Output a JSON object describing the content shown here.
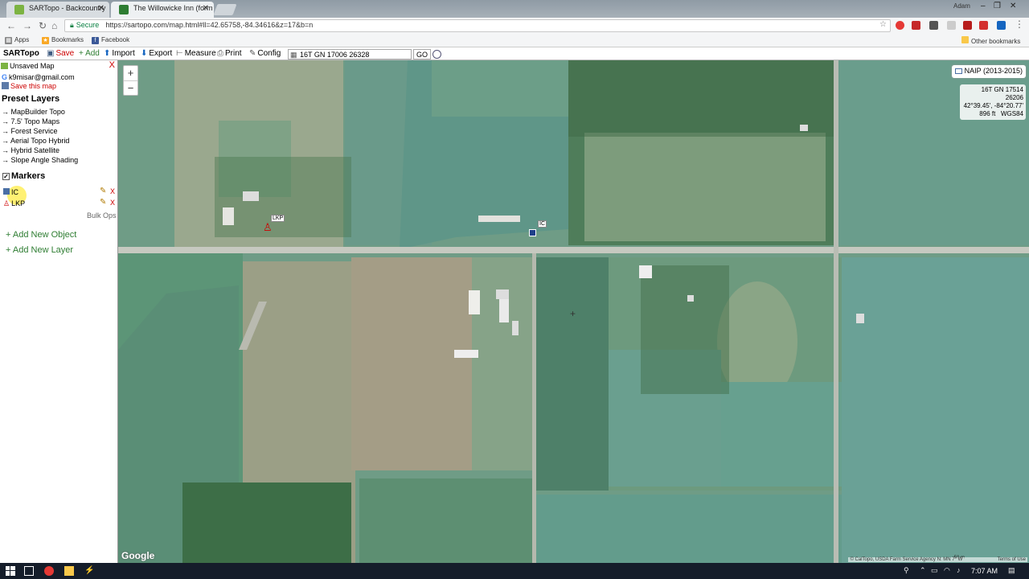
{
  "browser": {
    "tabs": [
      {
        "title": "SARTopo - Backcountry",
        "favicon_color": "#7cb342"
      },
      {
        "title": "The Willowicke Inn (form",
        "favicon_color": "#2e7d32"
      }
    ],
    "user": "Adam",
    "url": "https://sartopo.com/map.html#ll=42.65758,-84.34616&z=17&b=n",
    "secure_label": "Secure",
    "bookmarks": [
      {
        "label": "Apps"
      },
      {
        "label": "Bookmarks"
      },
      {
        "label": "Facebook"
      }
    ],
    "other_bookmarks": "Other bookmarks"
  },
  "toolbar": {
    "app_name": "SARTopo",
    "save": "Save",
    "add": "+ Add",
    "import": "Import",
    "export": "Export",
    "measure": "Measure",
    "print": "Print",
    "config": "Config",
    "coord_input": "16T GN 17006 26328",
    "go": "GO"
  },
  "sidebar": {
    "title": "Unsaved Map",
    "account": "k9misar@gmail.com",
    "save_map": "Save this map",
    "preset_heading": "Preset Layers",
    "preset_layers": [
      "MapBuilder Topo",
      "7.5' Topo Maps",
      "Forest Service",
      "Aerial Topo Hybrid",
      "Hybrid Satellite",
      "Slope Angle Shading"
    ],
    "markers_heading": "Markers",
    "markers": [
      {
        "label": "IC"
      },
      {
        "label": "LKP"
      }
    ],
    "bulk_ops": "Bulk Ops",
    "add_object": "+ Add New Object",
    "add_layer": "+ Add New Layer"
  },
  "map": {
    "layer_badge": "NAIP (2013-2015)",
    "cursor_coords": {
      "utm": "16T GN 17514 26206",
      "latlon": "42°39.45', -84°20.77'",
      "elevation": "896 ft",
      "datum": "WGS84"
    },
    "marker_labels": [
      "LKP",
      "IC"
    ],
    "attribution": "© CalTopo, USDA Farm Service Agency  N: MN 7° W",
    "scale": "50 m",
    "terms": "Terms of Use",
    "google": "Google"
  },
  "taskbar": {
    "time": "7:07 AM"
  },
  "colors": {
    "accent_red": "#cc0000",
    "add_green": "#2e7d32",
    "map_green": "#6f9c86"
  }
}
